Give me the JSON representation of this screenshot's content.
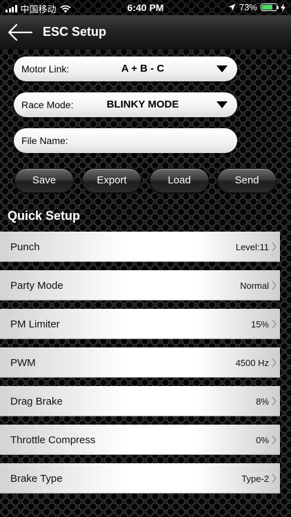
{
  "status_bar": {
    "carrier": "中国移动",
    "time": "6:40 PM",
    "battery": "73%",
    "icons": [
      "signal-icon",
      "wifi-icon",
      "location-icon",
      "battery-icon",
      "charging-icon"
    ],
    "battery_color": "#4cd964"
  },
  "navbar": {
    "title": "ESC Setup",
    "back_icon": "arrow-left-icon"
  },
  "form": {
    "motor_link": {
      "label": "Motor Link:",
      "value": "A + B - C"
    },
    "race_mode": {
      "label": "Race Mode:",
      "value": "BLINKY MODE"
    },
    "file_name": {
      "label": "File Name:",
      "value": "",
      "placeholder": ""
    }
  },
  "actions": {
    "save": "Save",
    "export": "Export",
    "load": "Load",
    "send": "Send"
  },
  "quick_setup": {
    "title": "Quick Setup",
    "items": [
      {
        "label": "Punch",
        "value": "Level:11"
      },
      {
        "label": "Party Mode",
        "value": "Normal"
      },
      {
        "label": "PM Limiter",
        "value": "15%"
      },
      {
        "label": "PWM",
        "value": "4500 Hz"
      },
      {
        "label": "Drag Brake",
        "value": "8%"
      },
      {
        "label": "Throttle Compress",
        "value": "0%"
      },
      {
        "label": "Brake Type",
        "value": "Type-2"
      }
    ]
  }
}
